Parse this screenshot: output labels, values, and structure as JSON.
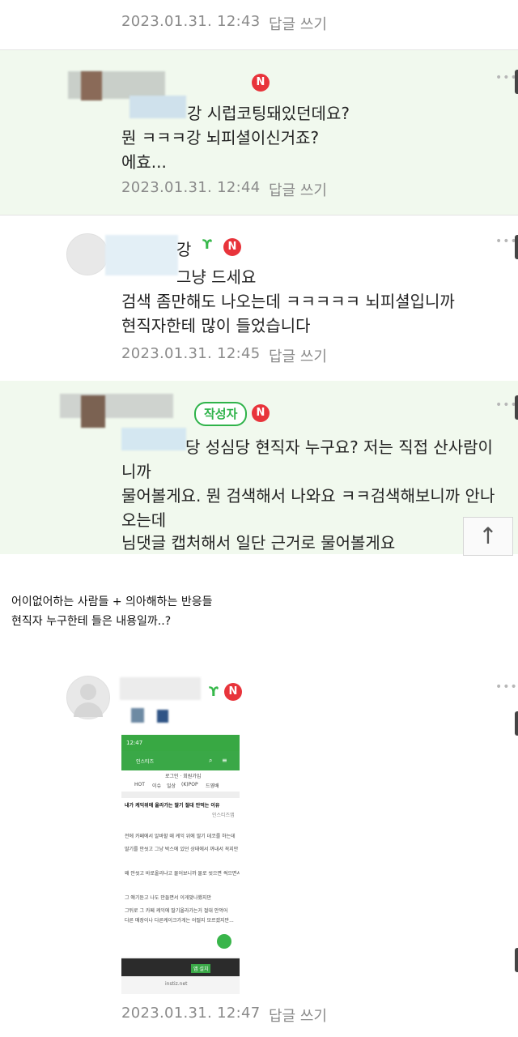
{
  "comments": [
    {
      "date": "2023.01.31. 12:43",
      "reply": "답글 쓰기"
    },
    {
      "name_fragment": "강",
      "badge": "N",
      "lines": [
        "강 시럽코팅돼있던데요?",
        "뭔 ㅋㅋㅋ강 뇌피셜이신거죠?",
        "에효..."
      ],
      "date": "2023.01.31. 12:44",
      "reply": "답글 쓰기"
    },
    {
      "name_fragment": "강",
      "badge": "N",
      "lines": [
        "그냥 드세요",
        "검색 좀만해도 나오는데 ㅋㅋㅋㅋㅋ 뇌피셜입니까",
        "현직자한테 많이 들었습니다"
      ],
      "date": "2023.01.31. 12:45",
      "reply": "답글 쓰기"
    },
    {
      "writer_badge": "작성자",
      "badge": "N",
      "lines": [
        "당 성심당 현직자 누구요? 저는 직접 산사람이",
        "니까",
        "물어볼게요. 뭔 검색해서 나와요 ㅋㅋ검색해보니까 안나",
        "오는데",
        "님댓글 캡처해서 일단 근거로 물어볼게요"
      ]
    },
    {
      "badge": "N",
      "date": "2023.01.31. 12:47",
      "reply": "답글 쓰기"
    }
  ],
  "more_label": "•••",
  "top_button": "↑",
  "captions": [
    "어이없어하는 사람들 + 의아해하는 반응들",
    "현직자 누구한테 들은 내용일까..?"
  ],
  "phone": {
    "time": "12:47",
    "site": "인스티즈",
    "login": "로그인 · 회원가입",
    "tabs": [
      "HOT",
      "이슈",
      "일상",
      "(K)POP",
      "드영배"
    ],
    "post_title": "내가 케익위에 올라가는 딸기 절대 안먹는 이유",
    "author": "인스티즈앱",
    "body": [
      "전에 카페에서 알바할 때 케익 위에 딸기 데코를 하는데",
      "딸기를 안씻고 그냥 박스에 있던 상태에서 꺼내서 꼭지만 떼서 올리는거야",
      "왜 안씻고 바로올리냐고 물어보니까 물로 씻으면 썩으면서 딸기들이 부당하면서 물렁해져서 금방 상해서 안된대",
      "그 얘기듣고 나도 만들면서 이게맞나했지만",
      "그뒤로 그 카페 케익에 딸기올라가는거 절대 안먹어",
      "다른 매장이나 다른케이크가게는 어떨지 모르겠지만..."
    ],
    "snackbar": "앱 설치",
    "url": "instiz.net"
  },
  "colors": {
    "highlight_bg": "#f1f9ee",
    "accent_green": "#2fb34a",
    "badge_red": "#e8343b",
    "meta_gray": "#8a8a8a"
  }
}
